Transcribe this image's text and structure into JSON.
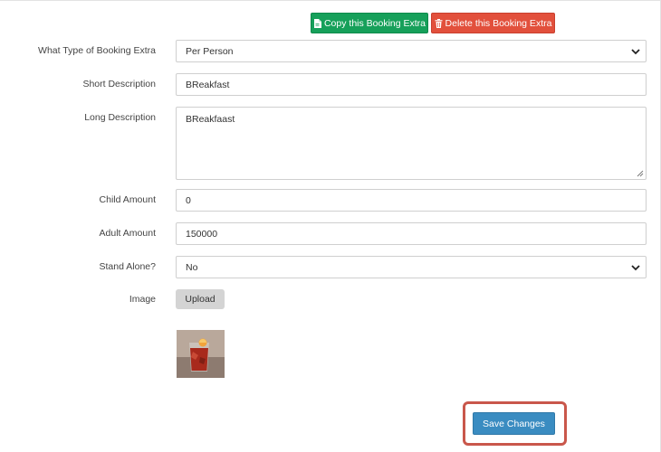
{
  "toolbar": {
    "copy_label": "Copy this Booking Extra",
    "delete_label": "Delete this Booking Extra"
  },
  "form": {
    "type": {
      "label": "What Type of Booking Extra",
      "selected": "Per Person"
    },
    "short_description": {
      "label": "Short Description",
      "value": "BReakfast"
    },
    "long_description": {
      "label": "Long Description",
      "value": "BReakfaast"
    },
    "child_amount": {
      "label": "Child Amount",
      "value": "0"
    },
    "adult_amount": {
      "label": "Adult Amount",
      "value": "150000"
    },
    "stand_alone": {
      "label": "Stand Alone?",
      "selected": "No"
    },
    "image": {
      "label": "Image",
      "upload_label": "Upload"
    }
  },
  "footer": {
    "save_label": "Save Changes"
  },
  "colors": {
    "copy_green": "#16a05a",
    "delete_red": "#e2503c",
    "save_blue": "#3a8cc1",
    "highlight_red": "#c9574b"
  },
  "icons": [
    "file-icon",
    "trash-icon",
    "chevron-down-icon",
    "resize-handle-icon"
  ]
}
